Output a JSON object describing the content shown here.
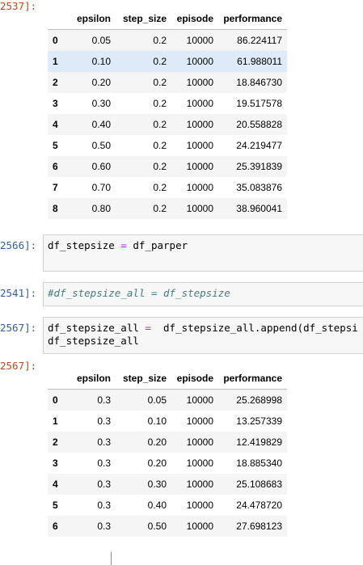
{
  "cells": [
    {
      "prompt": "2537]:"
    },
    {
      "prompt": "2566]:",
      "code": {
        "lhs": "df_stepsize",
        "op": "=",
        "rhs": "df_parper"
      }
    },
    {
      "prompt": "2541]:",
      "comment": "#df_stepsize_all = df_stepsize"
    },
    {
      "prompt": "2567]:",
      "code_line1": {
        "lhs": "df_stepsize_all",
        "op": "=",
        "rhs": "  df_stepsize_all.append(df_stepsi"
      },
      "code_line2": "df_stepsize_all"
    },
    {
      "prompt": "2567]:"
    }
  ],
  "table1": {
    "columns": [
      "epsilon",
      "step_size",
      "episode",
      "performance"
    ],
    "rows": [
      {
        "idx": "0",
        "epsilon": "0.05",
        "step_size": "0.2",
        "episode": "10000",
        "performance": "86.224117"
      },
      {
        "idx": "1",
        "epsilon": "0.10",
        "step_size": "0.2",
        "episode": "10000",
        "performance": "61.988011"
      },
      {
        "idx": "2",
        "epsilon": "0.20",
        "step_size": "0.2",
        "episode": "10000",
        "performance": "18.846730"
      },
      {
        "idx": "3",
        "epsilon": "0.30",
        "step_size": "0.2",
        "episode": "10000",
        "performance": "19.517578"
      },
      {
        "idx": "4",
        "epsilon": "0.40",
        "step_size": "0.2",
        "episode": "10000",
        "performance": "20.558828"
      },
      {
        "idx": "5",
        "epsilon": "0.50",
        "step_size": "0.2",
        "episode": "10000",
        "performance": "24.219477"
      },
      {
        "idx": "6",
        "epsilon": "0.60",
        "step_size": "0.2",
        "episode": "10000",
        "performance": "25.391839"
      },
      {
        "idx": "7",
        "epsilon": "0.70",
        "step_size": "0.2",
        "episode": "10000",
        "performance": "35.083876"
      },
      {
        "idx": "8",
        "epsilon": "0.80",
        "step_size": "0.2",
        "episode": "10000",
        "performance": "38.960041"
      }
    ]
  },
  "table2": {
    "columns": [
      "epsilon",
      "step_size",
      "episode",
      "performance"
    ],
    "rows": [
      {
        "idx": "0",
        "epsilon": "0.3",
        "step_size": "0.05",
        "episode": "10000",
        "performance": "25.268998"
      },
      {
        "idx": "1",
        "epsilon": "0.3",
        "step_size": "0.10",
        "episode": "10000",
        "performance": "13.257339"
      },
      {
        "idx": "2",
        "epsilon": "0.3",
        "step_size": "0.20",
        "episode": "10000",
        "performance": "12.419829"
      },
      {
        "idx": "3",
        "epsilon": "0.3",
        "step_size": "0.20",
        "episode": "10000",
        "performance": "18.885340"
      },
      {
        "idx": "4",
        "epsilon": "0.3",
        "step_size": "0.30",
        "episode": "10000",
        "performance": "25.108683"
      },
      {
        "idx": "5",
        "epsilon": "0.3",
        "step_size": "0.40",
        "episode": "10000",
        "performance": "24.478720"
      },
      {
        "idx": "6",
        "epsilon": "0.3",
        "step_size": "0.50",
        "episode": "10000",
        "performance": "27.698123"
      }
    ]
  },
  "colors": {
    "out_prompt": "#c0461b",
    "in_prompt": "#30609f",
    "row_highlight": "#ddebf8",
    "row_stripe": "#f5f5f5",
    "operator": "#aa22ff",
    "comment": "#408080"
  }
}
